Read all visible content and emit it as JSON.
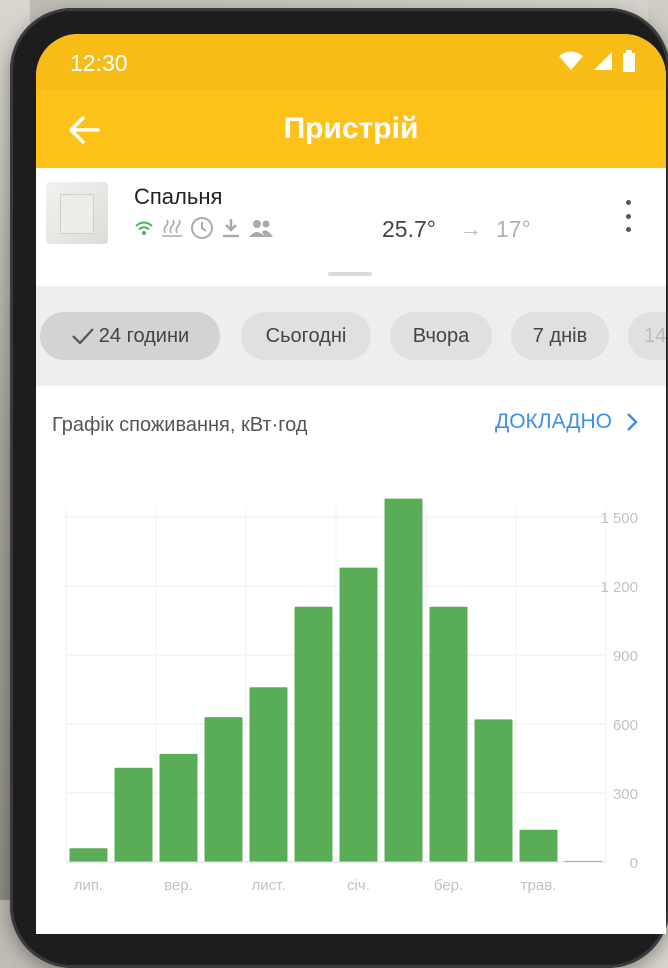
{
  "status_bar": {
    "time": "12:30",
    "icons": [
      "wifi-icon",
      "signal-icon",
      "battery-icon"
    ]
  },
  "app_bar": {
    "title": "Пристрій",
    "back_icon": "arrow-left-icon"
  },
  "device": {
    "name": "Спальня",
    "status_icons": [
      "wifi-icon",
      "heating-icon",
      "clock-icon",
      "download-icon",
      "users-icon"
    ],
    "current_temp": "25.7°",
    "target_temp": "17°",
    "menu_icon": "more-vert-icon"
  },
  "filters": {
    "chips": [
      {
        "label": "24 години",
        "selected": true
      },
      {
        "label": "Сьогодні",
        "selected": false
      },
      {
        "label": "Вчора",
        "selected": false
      },
      {
        "label": "7 днів",
        "selected": false
      },
      {
        "label": "14",
        "selected": false
      }
    ]
  },
  "chart_header": {
    "title": "Графік споживання, кВт·год",
    "details_label": "ДОКЛАДНО"
  },
  "colors": {
    "accent": "#fdc21a",
    "bar": "#5aad57",
    "link": "#3f8fe8"
  },
  "chart_data": {
    "type": "bar",
    "title": "Графік споживання, кВт·год",
    "values": [
      60,
      410,
      470,
      630,
      760,
      1110,
      1280,
      1580,
      1110,
      620,
      140,
      5
    ],
    "x_tick_labels": [
      "лип.",
      "вер.",
      "лист.",
      "січ.",
      "бер.",
      "трав."
    ],
    "y_tick_labels": [
      "1 500",
      "1 200",
      "900",
      "600",
      "300",
      "0"
    ],
    "ylim": [
      0,
      1500
    ],
    "grid": true
  }
}
